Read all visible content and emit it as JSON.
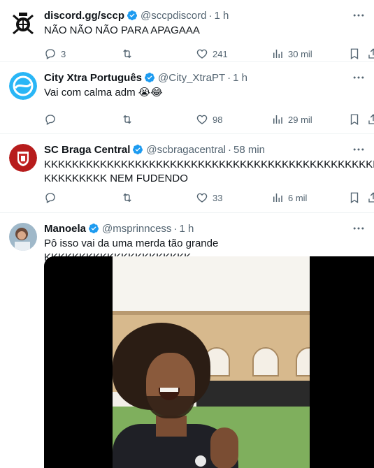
{
  "tweets": [
    {
      "name": "discord.gg/sccp",
      "handle": "@sccpdiscord",
      "time": "1 h",
      "text": "NÃO NÃO NÃO PARA APAGAAA",
      "replies": "3",
      "retweets": "",
      "likes": "241",
      "views": "30 mil"
    },
    {
      "name": "City Xtra Português",
      "handle": "@City_XtraPT",
      "time": "1 h",
      "text": "Vai com calma adm 😭😂",
      "replies": "",
      "retweets": "",
      "likes": "98",
      "views": "29 mil"
    },
    {
      "name": "SC Braga Central",
      "handle": "@scbragacentral",
      "time": "58 min",
      "text_line1": "KKKKKKKKKKKKKKKKKKKKKKKKKKKKKKKKKKKKKKKKKKKKKKKKKKKKKK",
      "text_line2": "KKKKKKKKK NEM FUDENDO",
      "replies": "",
      "retweets": "",
      "likes": "33",
      "views": "6 mil"
    },
    {
      "name": "Manoela",
      "handle": "@msprinncess",
      "time": "1 h",
      "text": "Pô isso vai da uma merda tão grande KKKKKKKKKKKKKKKKKKKKK"
    }
  ],
  "separator": "·",
  "colors": {
    "verified": "#1d9bf0",
    "secondary_text": "#536471",
    "divider": "#eff3f4"
  },
  "icons": [
    "reply-icon",
    "retweet-icon",
    "like-icon",
    "views-icon",
    "bookmark-icon",
    "share-icon",
    "verified-badge-icon",
    "more-icon"
  ]
}
